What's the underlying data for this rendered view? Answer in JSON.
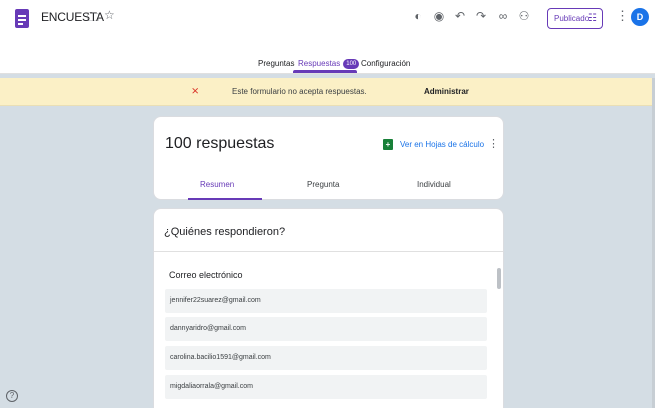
{
  "header": {
    "title": "ENCUESTA",
    "publish_label": "Publicado",
    "avatar_letter": "D"
  },
  "tabs": [
    {
      "label": "Preguntas"
    },
    {
      "label": "Respuestas",
      "count": "100"
    },
    {
      "label": "Configuración"
    }
  ],
  "banner": {
    "message": "Este formulario no acepta respuestas.",
    "action": "Administrar"
  },
  "summary_card": {
    "title": "100 respuestas",
    "sheets_link": "Ver en Hojas de cálculo",
    "views": [
      "Resumen",
      "Pregunta",
      "Individual"
    ]
  },
  "respondents": {
    "title": "¿Quiénes respondieron?",
    "field_label": "Correo electrónico",
    "emails": [
      "jennifer22suarez@gmail.com",
      "dannyaridro@gmail.com",
      "carolina.bacilio1591@gmail.com",
      "migdaliaorrala@gmail.com"
    ]
  },
  "colors": {
    "accent": "#673ab7",
    "banner_bg": "#fbf0c6",
    "page_bg": "#d4dde4",
    "link": "#1a73e8",
    "sheets": "#188038"
  },
  "icons": [
    "forms-app-icon",
    "folder-icon",
    "star-icon",
    "palette-icon",
    "preview-icon",
    "undo-icon",
    "redo-icon",
    "link-icon",
    "add-collaborator-icon",
    "publish-settings-icon",
    "more-vert-icon",
    "no-responses-icon",
    "sheets-icon",
    "help-icon"
  ]
}
